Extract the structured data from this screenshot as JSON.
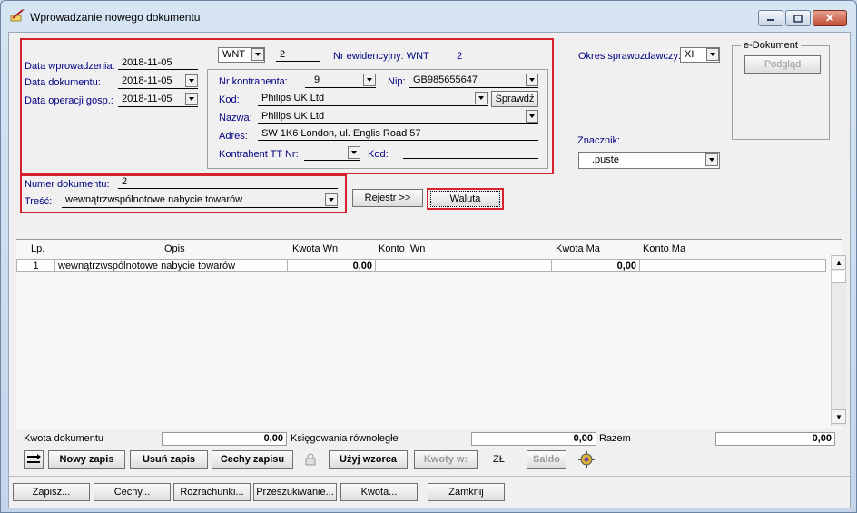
{
  "window": {
    "title": "Wprowadzanie nowego dokumentu",
    "min_label": "▭",
    "max_label": "▢",
    "close_label": "✕"
  },
  "header": {
    "data_wprowadzenia_label": "Data wprowadzenia:",
    "data_wprowadzenia": "2018-11-05",
    "data_dokumentu_label": "Data dokumentu:",
    "data_dokumentu": "2018-11-05",
    "data_operacji_label": "Data operacji gosp.:",
    "data_operacji": "2018-11-05",
    "typ": "WNT",
    "numer": "2",
    "nr_ewid_label": "Nr ewidencyjny: WNT",
    "nr_ewid_value": "2"
  },
  "kontrahent": {
    "nr_label": "Nr kontrahenta:",
    "nr_value": "9",
    "nip_label": "Nip:",
    "nip_value": "GB985655647",
    "kod_label": "Kod:",
    "kod_value": "Philips UK Ltd",
    "sprawdz_label": "Sprawdź",
    "nazwa_label": "Nazwa:",
    "nazwa_value": "Philips UK Ltd",
    "adres_label": "Adres:",
    "adres_value": "SW 1K6 London, ul. Englis Road 57",
    "tt_label": "Kontrahent TT Nr:",
    "tt_value": "",
    "kod2_label": "Kod:",
    "kod2_value": ""
  },
  "okres": {
    "label": "Okres sprawozdawczy:",
    "value": "XI"
  },
  "edokument": {
    "legend": "e-Dokument",
    "podglad_label": "Podgląd"
  },
  "znacznik": {
    "label": "Znacznik:",
    "value": ".puste"
  },
  "dokument": {
    "numer_label": "Numer dokumentu:",
    "numer_value": "2",
    "tresc_label": "Treść:",
    "tresc_value": "wewnątrzwspólnotowe nabycie towarów",
    "rejestr_label": "Rejestr >>",
    "waluta_label": "Waluta"
  },
  "grid": {
    "columns": [
      "Lp.",
      "Opis",
      "Kwota Wn",
      "Konto  Wn",
      "Kwota Ma",
      "Konto Ma"
    ],
    "rows": [
      {
        "lp": "1",
        "opis": "wewnątrzwspólnotowe nabycie towarów",
        "kwota_wn": "0,00",
        "konto_wn": "",
        "kwota_ma": "0,00",
        "konto_ma": ""
      }
    ]
  },
  "summary": {
    "kwota_dok_label": "Kwota dokumentu",
    "kwota_dok_value": "0,00",
    "ksieg_label": "Księgowania równoległe",
    "ksieg_value": "0,00",
    "razem_label": "Razem",
    "razem_value": "0,00"
  },
  "toolbar": {
    "nowy_zapis": "Nowy zapis",
    "usun_zapis": "Usuń zapis",
    "cechy_zapisu": "Cechy zapisu",
    "uzyj_wzorca": "Użyj wzorca",
    "kwoty_w": "Kwoty w:",
    "currency": "ZŁ",
    "saldo": "Saldo"
  },
  "bottom": {
    "zapisz": "Zapisz...",
    "cechy": "Cechy...",
    "rozrachunki": "Rozrachunki...",
    "przeszukiwanie": "Przeszukiwanie...",
    "kwota": "Kwota...",
    "zamknij": "Zamknij"
  },
  "colors": {
    "highlight_red": "#d6212e",
    "accent_blue": "#000080"
  }
}
